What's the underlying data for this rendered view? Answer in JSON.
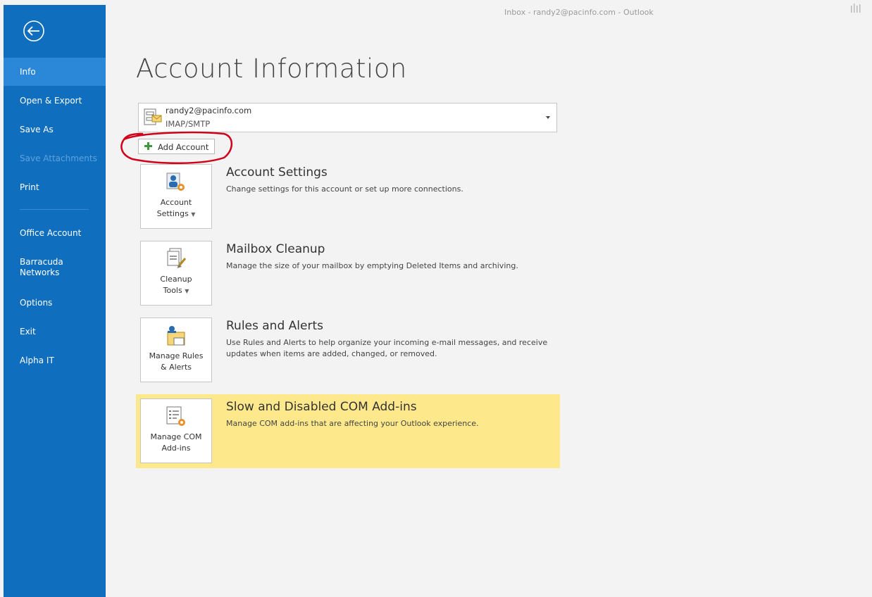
{
  "window": {
    "title": "Inbox - randy2@pacinfo.com - Outlook"
  },
  "sidebar": {
    "items": [
      {
        "label": "Info"
      },
      {
        "label": "Open & Export"
      },
      {
        "label": "Save As"
      },
      {
        "label": "Save Attachments"
      },
      {
        "label": "Print"
      },
      {
        "label": "Office Account"
      },
      {
        "label": "Barracuda\nNetworks"
      },
      {
        "label": "Options"
      },
      {
        "label": "Exit"
      },
      {
        "label": "Alpha IT"
      }
    ]
  },
  "main": {
    "title": "Account Information",
    "account": {
      "email": "randy2@pacinfo.com",
      "type": "IMAP/SMTP"
    },
    "add_account_label": "Add Account",
    "sections": [
      {
        "tile_line1": "Account",
        "tile_line2": "Settings",
        "title": "Account Settings",
        "desc": "Change settings for this account or set up more connections."
      },
      {
        "tile_line1": "Cleanup",
        "tile_line2": "Tools",
        "title": "Mailbox Cleanup",
        "desc": "Manage the size of your mailbox by emptying Deleted Items and archiving."
      },
      {
        "tile_line1": "Manage Rules",
        "tile_line2": "& Alerts",
        "title": "Rules and Alerts",
        "desc": "Use Rules and Alerts to help organize your incoming e-mail messages, and receive updates when items are added, changed, or removed."
      },
      {
        "tile_line1": "Manage COM",
        "tile_line2": "Add-ins",
        "title": "Slow and Disabled COM Add-ins",
        "desc": "Manage COM add-ins that are affecting your Outlook experience."
      }
    ]
  },
  "colors": {
    "sidebar": "#106ebe",
    "sidebar_active": "#2b88d8",
    "warning": "#fde98c",
    "annotation": "#d0021b"
  }
}
